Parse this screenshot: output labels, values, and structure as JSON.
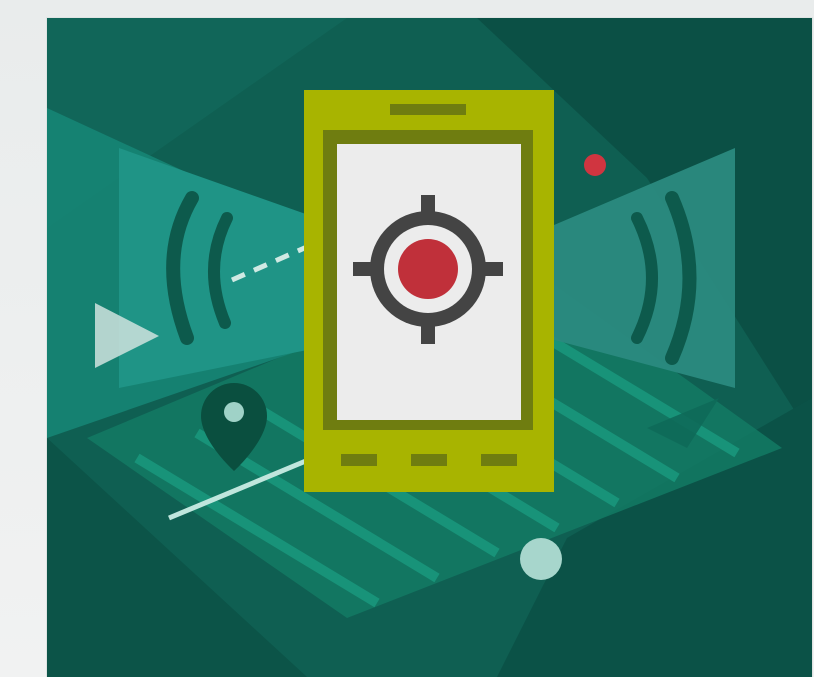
{
  "illustration": {
    "colors": {
      "background": "#0f5f52",
      "background_dark": "#0a4c41",
      "teal_panel": "#1d8c80",
      "teal_panel_light": "#2c9b8e",
      "grid": "#11806a",
      "phone_body": "#a8b400",
      "phone_bezel": "#6f7d10",
      "screen": "#ececec",
      "target_ring": "#444444",
      "target_center": "#c0303a",
      "accent_dot": "#d03540",
      "pin": "#0a4f3f",
      "light_dot": "#9fd2c7"
    },
    "icons": [
      "smartphone-icon",
      "crosshair-target-icon",
      "location-pin-icon",
      "signal-waves-icon",
      "play-arrow-icon"
    ]
  }
}
